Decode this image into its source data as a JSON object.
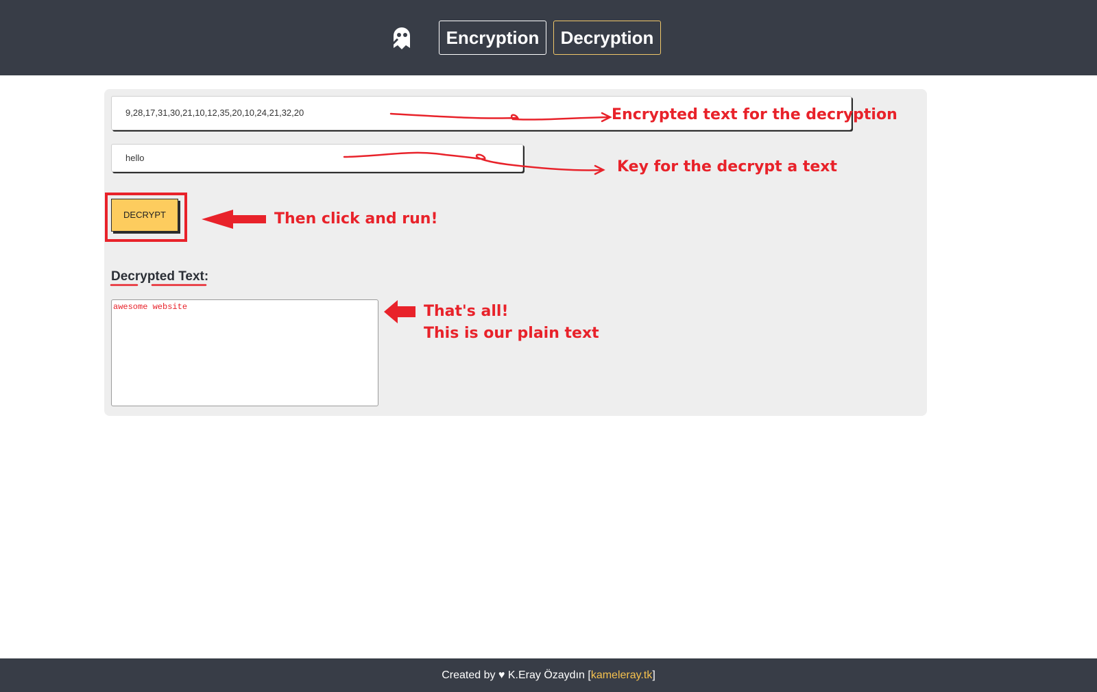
{
  "header": {
    "logo_icon": "ghost-wand-icon",
    "nav": {
      "encryption_label": "Encryption",
      "decryption_label": "Decryption"
    }
  },
  "form": {
    "ciphertext_value": "9,28,17,31,30,21,10,12,35,20,10,24,21,32,20",
    "key_value": "hello",
    "decrypt_button_label": "DECRYPT",
    "result_label": "Decrypted Text:",
    "result_value": "awesome website"
  },
  "annotations": {
    "ciphertext_note": "Encrypted text for the decryption",
    "key_note": "Key for the decrypt a text",
    "button_note": "Then click and run!",
    "result_note_line1": "That's all!",
    "result_note_line2": "This is our plain text",
    "color": "#e8222a"
  },
  "footer": {
    "prefix": "Created by ♥ K.Eray Özaydın [",
    "link_text": "kameleray.tk",
    "suffix": "]"
  },
  "colors": {
    "header_bg": "#383d47",
    "accent": "#fdcc5e",
    "panel_bg": "#eeeeee"
  }
}
